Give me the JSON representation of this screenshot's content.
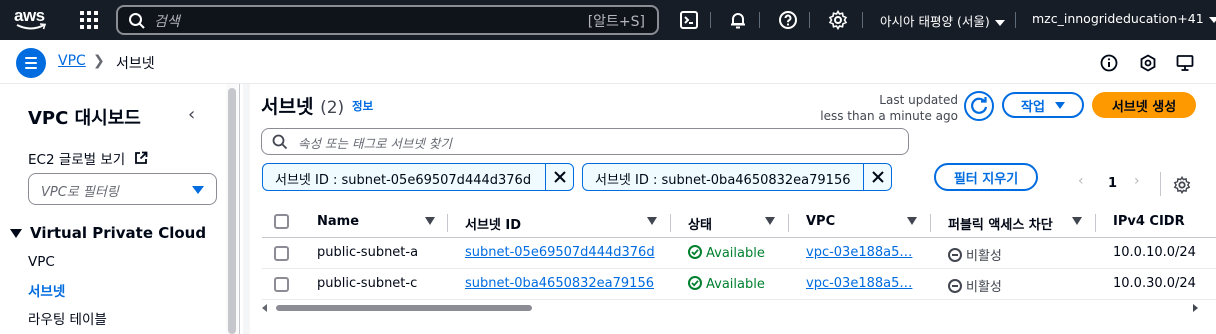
{
  "topbar": {
    "logo_text": "aws",
    "search_placeholder": "검색",
    "search_shortcut": "[알트+S]",
    "region": "아시아 태평양 (서울)",
    "account": "mzc_innogrideducation+41"
  },
  "breadcrumb": {
    "items": [
      "VPC",
      "서브넷"
    ]
  },
  "sidebar": {
    "title": "VPC 대시보드",
    "ec2_link": "EC2 글로벌 보기",
    "filter_placeholder": "VPC로 필터링",
    "section": "Virtual Private Cloud",
    "items": [
      "VPC",
      "서브넷",
      "라우팅 테이블"
    ],
    "active_index": 1
  },
  "header": {
    "title": "서브넷",
    "count": "(2)",
    "info": "정보",
    "last_updated_1": "Last updated",
    "last_updated_2": "less than a minute ago",
    "actions_label": "작업",
    "create_label": "서브넷 생성"
  },
  "filter": {
    "placeholder": "속성 또는 태그로 서브넷 찾기",
    "tokens": [
      "서브넷 ID : subnet-05e69507d444d376d",
      "서브넷 ID : subnet-0ba4650832ea79156"
    ],
    "clear_label": "필터 지우기"
  },
  "pagination": {
    "prev": "‹",
    "page": "1",
    "next": "›"
  },
  "table": {
    "columns": [
      "Name",
      "서브넷 ID",
      "상태",
      "VPC",
      "퍼블릭 액세스 차단",
      "IPv4 CIDR"
    ],
    "rows": [
      {
        "name": "public-subnet-a",
        "subnet_id": "subnet-05e69507d444d376d",
        "status": "Available",
        "vpc": "vpc-03e188a5…",
        "block": "비활성",
        "cidr": "10.0.10.0/24"
      },
      {
        "name": "public-subnet-c",
        "subnet_id": "subnet-0ba4650832ea79156",
        "status": "Available",
        "vpc": "vpc-03e188a5…",
        "block": "비활성",
        "cidr": "10.0.30.0/24"
      }
    ]
  },
  "colors": {
    "topbar_bg": "#161d26",
    "link_blue": "#006ce0",
    "primary_orange": "#ff9900",
    "success_green": "#00802f"
  },
  "icons": [
    "grid-icon",
    "search-icon",
    "cloudshell-icon",
    "bell-icon",
    "help-icon",
    "gear-icon",
    "info-icon",
    "hexagon-icon",
    "monitor-icon",
    "refresh-icon",
    "close-icon",
    "external-link-icon",
    "success-icon",
    "disabled-icon"
  ]
}
